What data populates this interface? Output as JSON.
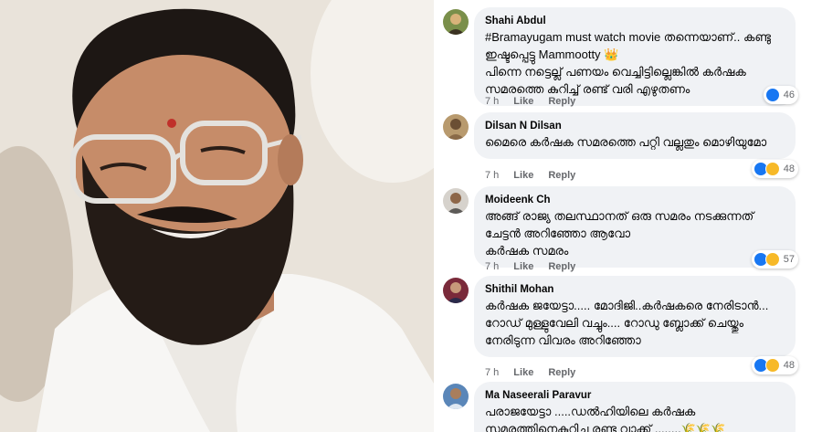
{
  "colors": {
    "link": "#050505",
    "meta": "#65676b",
    "bubble": "#f0f2f5",
    "like": "#1877f2",
    "haha": "#f7b928"
  },
  "comments": [
    {
      "author": "Shahi Abdul",
      "text": "#Bramayugam must watch movie തന്നെയാണ്.. കണ്ടു ഇഷ്ടപ്പെട്ടു Mammootty 👑\nപിന്നെ നട്ടെല്ല് പണയം വെച്ചിട്ടില്ലെങ്കിൽ കർഷക സമരത്തെ കുറിച്ച് രണ്ട് വരി എഴുതണം",
      "time": "7 h",
      "like": "Like",
      "reply": "Reply",
      "reactions": [
        "like-icon"
      ],
      "count": "46"
    },
    {
      "author": "Dilsan N Dilsan",
      "text": "മൈരെ കർഷക സമരത്തെ പറ്റി വല്ലതും മൊഴിയുമോ",
      "time": "7 h",
      "like": "Like",
      "reply": "Reply",
      "reactions": [
        "like-icon",
        "haha-icon"
      ],
      "count": "48"
    },
    {
      "author": "Moideenk Ch",
      "text": "അങ്ങ് രാജ്യ തലസ്ഥാനത് ഒരു സമരം നടക്കുന്നത് ചേട്ടൻ അറിഞ്ഞോ ആവോ\nകർഷക സമരം",
      "time": "7 h",
      "like": "Like",
      "reply": "Reply",
      "reactions": [
        "like-icon",
        "haha-icon"
      ],
      "count": "57"
    },
    {
      "author": "Shithil Mohan",
      "text": "കർഷക ജയേട്ടാ..... മോദിജി..കർഷകരെ നേരിടാൻ... റോഡ് മുള്ളുവേലി വച്ചും.... റോഡു ബ്ലോക്ക് ചെയ്തും നേരിടുന്ന വിവരം അറിഞ്ഞോ",
      "time": "7 h",
      "like": "Like",
      "reply": "Reply",
      "reactions": [
        "like-icon",
        "haha-icon"
      ],
      "count": "48"
    },
    {
      "author": "Ma Naseerali Paravur",
      "text": "പരാജയേട്ടാ .....ഡൽഹിയിലെ കർഷക സമരത്തിനെകുറിച്ചു രണ്ടു വാക്ക് ........🌾🌾🌾",
      "time": "",
      "like": "",
      "reply": "",
      "reactions": [],
      "count": ""
    }
  ]
}
